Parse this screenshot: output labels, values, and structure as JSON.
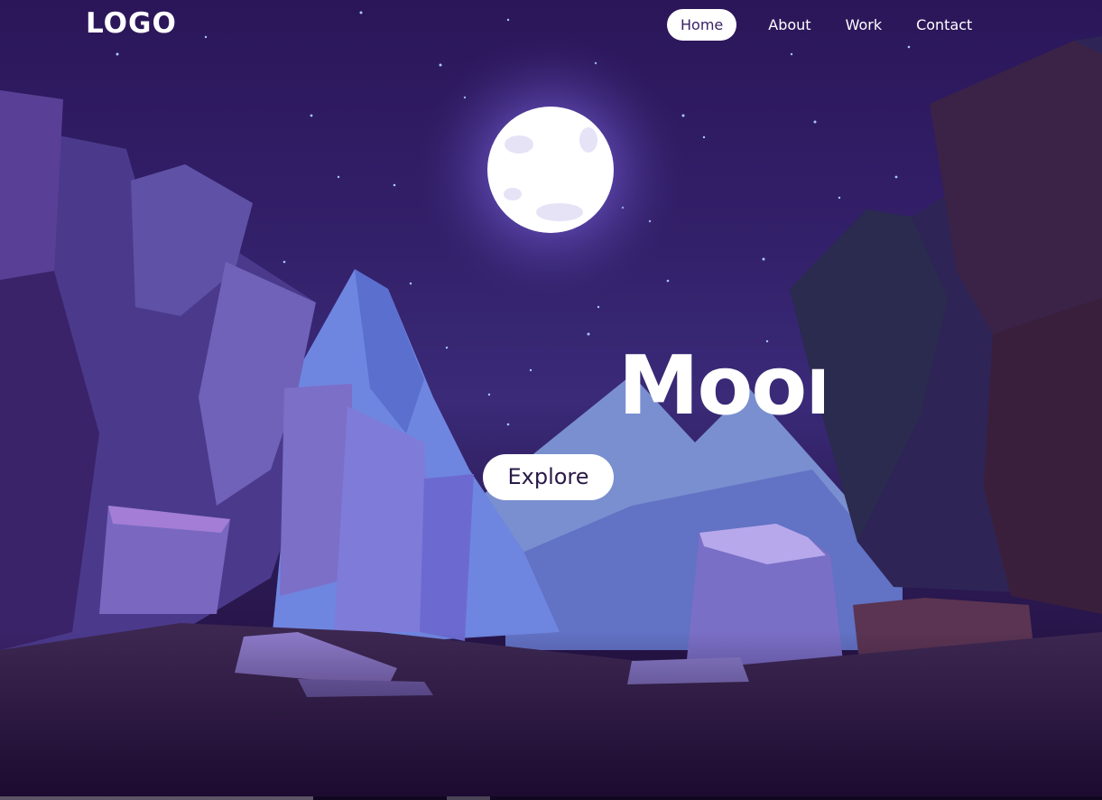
{
  "header": {
    "logo": "LOGO",
    "nav": [
      {
        "label": "Home",
        "active": true
      },
      {
        "label": "About",
        "active": false
      },
      {
        "label": "Work",
        "active": false
      },
      {
        "label": "Contact",
        "active": false
      }
    ]
  },
  "hero": {
    "title": "Moon",
    "button_label": "Explore"
  },
  "colors": {
    "sky": "#2b1659",
    "moon": "#ffffff",
    "moon_glow": "#8f7bff",
    "mountain": "#6f86d8",
    "cliff": "#4b3a8c",
    "ground": "#1c0a30",
    "nav_active_bg": "#ffffff",
    "nav_active_text": "#3a2366"
  }
}
